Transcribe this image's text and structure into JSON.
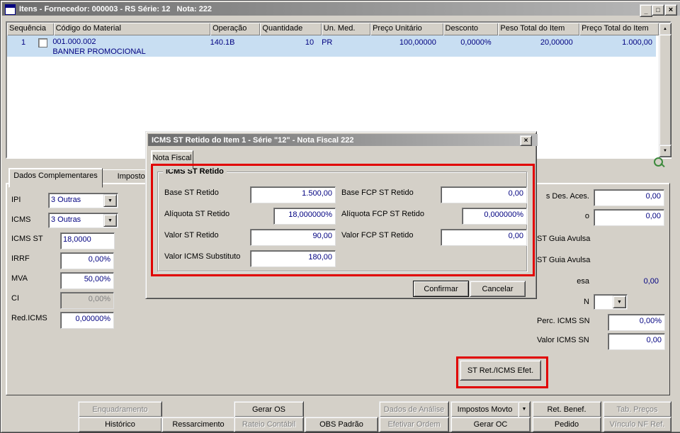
{
  "window": {
    "title": "Itens - Fornecedor: 000003 - RS Série: 12   Nota: 222",
    "minimize": "_",
    "maximize": "□",
    "close": "×"
  },
  "icons": {
    "up": "▲",
    "down": "▼",
    "combo": "▼"
  },
  "grid": {
    "columns": [
      "Sequência",
      "Código do Material",
      "Operação",
      "Quantidade",
      "Un. Med.",
      "Preço Unitário",
      "Desconto",
      "Peso Total do Item",
      "Preço Total do Item"
    ],
    "row": {
      "seq": "1",
      "codigo": "001.000.002",
      "descricao": "BANNER PROMOCIONAL",
      "operacao": "140.1B",
      "quantidade": "10",
      "un_med": "PR",
      "preco_unitario": "100,00000",
      "desconto": "0,0000%",
      "peso_total": "20,00000",
      "preco_total": "1.000,00"
    }
  },
  "tabs": {
    "tab1": "Dados Complementares",
    "tab2": "Impostos"
  },
  "left_fields": [
    {
      "label": "IPI",
      "value": "3 Outras"
    },
    {
      "label": "ICMS",
      "value": "3 Outras"
    },
    {
      "label": "ICMS ST",
      "value": "18,0000"
    },
    {
      "label": "IRRF",
      "value": "0,00%"
    },
    {
      "label": "MVA",
      "value": "50,00%"
    },
    {
      "label": "CI",
      "value": "0,00%"
    },
    {
      "label": "Red.ICMS",
      "value": "0,00000%"
    }
  ],
  "right_fields": {
    "r1_label": "s Des. Aces.",
    "r1_value": "0,00",
    "r2_label": "o",
    "r2_value": "0,00",
    "r3_label": "ST Guia Avulsa",
    "r4_label": "ST Guia Avulsa",
    "r5_label": "esa",
    "r5_value": "0,00",
    "r6_label": "N",
    "r7_label": "Perc. ICMS SN",
    "r7_value": "0,00%",
    "r8_label": "Valor ICMS SN",
    "r8_value": "0,00"
  },
  "st_ret_button": "ST Ret./ICMS Efet.",
  "dialog": {
    "title": "ICMS ST Retido do Item 1 - Série \"12\" - Nota Fiscal 222",
    "close": "×",
    "tab": "Nota Fiscal",
    "group_title": "ICMS ST Retido",
    "left": [
      {
        "label": "Base ST Retido",
        "value": "1.500,00"
      },
      {
        "label": "Alíquota ST Retido",
        "value": "18,000000%"
      },
      {
        "label": "Valor ST Retido",
        "value": "90,00"
      },
      {
        "label": "Valor ICMS Substituto",
        "value": "180,00"
      }
    ],
    "right": [
      {
        "label": "Base FCP ST Retido",
        "value": "0,00"
      },
      {
        "label": "Alíquota FCP ST Retido",
        "value": "0,000000%"
      },
      {
        "label": "Valor FCP ST Retido",
        "value": "0,00"
      }
    ],
    "confirm": "Confirmar",
    "cancel": "Cancelar"
  },
  "buttons": {
    "row1": [
      {
        "label": "Enquadramento"
      },
      {
        "label": "Gerar OS"
      },
      {
        "label": "Dados de Análise"
      },
      {
        "label": "Impostos Movto"
      },
      {
        "label": "Ret. Benef."
      },
      {
        "label": "Tab. Preços"
      }
    ],
    "row2": [
      {
        "label": "Histórico"
      },
      {
        "label": "Ressarcimento"
      },
      {
        "label": "Rateio Contábil"
      },
      {
        "label": "OBS Padrão"
      },
      {
        "label": "Efetivar Ordem"
      },
      {
        "label": "Gerar OC"
      },
      {
        "label": "Pedido"
      },
      {
        "label": "Vínculo NF Ref."
      }
    ]
  },
  "colors": {
    "annotation": "#e10000",
    "selection": "#c8def2",
    "field_text": "#000080"
  }
}
